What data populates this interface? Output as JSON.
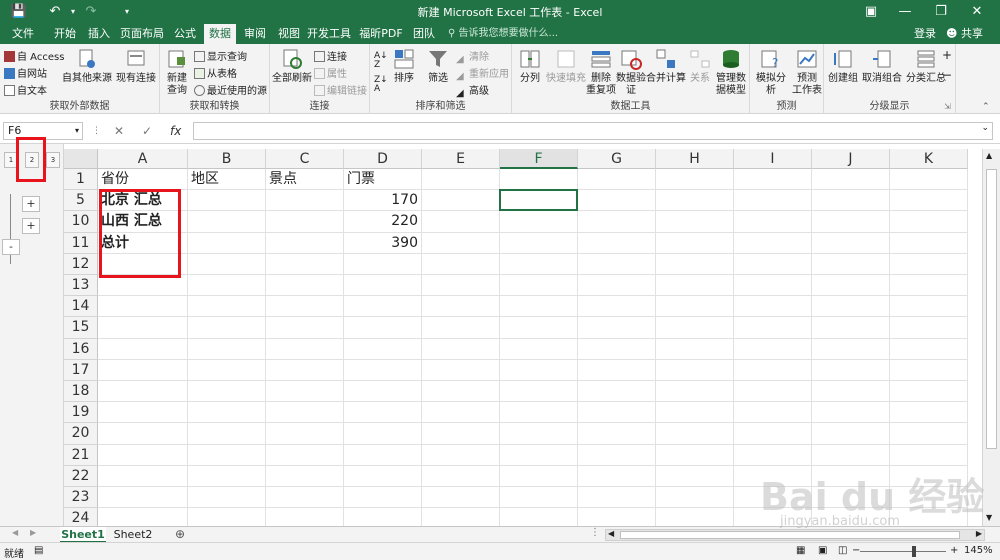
{
  "window": {
    "title": "新建 Microsoft Excel 工作表 - Excel"
  },
  "menu": {
    "tabs": [
      "文件",
      "开始",
      "插入",
      "页面布局",
      "公式",
      "数据",
      "审阅",
      "视图",
      "开发工具",
      "福昕PDF",
      "团队"
    ],
    "active": "数据",
    "tell_me": "告诉我您想要做什么...",
    "login": "登录",
    "share": "共享"
  },
  "ribbon": {
    "get_external": {
      "access": "自 Access",
      "web": "自网站",
      "text": "自文本",
      "other": "自其他来源",
      "existing": "现有连接",
      "label": "获取外部数据"
    },
    "get_transform": {
      "new_query": "新建\n查询",
      "show_queries": "显示查询",
      "from_table": "从表格",
      "recent_sources": "最近使用的源",
      "label": "获取和转换"
    },
    "connections": {
      "refresh_all": "全部刷新",
      "connections": "连接",
      "properties": "属性",
      "edit_links": "编辑链接",
      "label": "连接"
    },
    "sort_filter": {
      "sort": "排序",
      "filter": "筛选",
      "clear": "清除",
      "reapply": "重新应用",
      "advanced": "高级",
      "label": "排序和筛选"
    },
    "data_tools": {
      "text_to_columns": "分列",
      "flash_fill": "快速填充",
      "remove_dup": "删除\n重复项",
      "validation": "数据验\n证",
      "consolidate": "合并计算",
      "relationships": "关系",
      "manage_model": "管理数\n据模型",
      "label": "数据工具"
    },
    "forecast": {
      "what_if": "模拟分析",
      "forecast_sheet": "预测\n工作表",
      "label": "预测"
    },
    "outline": {
      "group": "创建组",
      "ungroup": "取消组合",
      "subtotal": "分类汇总",
      "label": "分级显示"
    }
  },
  "formula_bar": {
    "name_box": "F6",
    "fx": "fx",
    "formula": ""
  },
  "outline_levels": [
    "1",
    "2",
    "3"
  ],
  "outline_buttons": [
    "+",
    "+",
    "-"
  ],
  "columns": [
    "A",
    "B",
    "C",
    "D",
    "E",
    "F",
    "G",
    "H",
    "I",
    "J",
    "K"
  ],
  "selected_column": "F",
  "rows": [
    {
      "num": "1",
      "cells": {
        "A": "省份",
        "B": "地区",
        "C": "景点",
        "D": "门票"
      }
    },
    {
      "num": "5",
      "cells": {
        "A": "北京 汇总",
        "D": "170"
      }
    },
    {
      "num": "10",
      "cells": {
        "A": "山西 汇总",
        "D": "220"
      }
    },
    {
      "num": "11",
      "cells": {
        "A": "总计",
        "D": "390"
      }
    },
    {
      "num": "12",
      "cells": {}
    },
    {
      "num": "13",
      "cells": {}
    },
    {
      "num": "14",
      "cells": {}
    },
    {
      "num": "15",
      "cells": {}
    },
    {
      "num": "16",
      "cells": {}
    },
    {
      "num": "17",
      "cells": {}
    },
    {
      "num": "18",
      "cells": {}
    },
    {
      "num": "19",
      "cells": {}
    },
    {
      "num": "20",
      "cells": {}
    },
    {
      "num": "21",
      "cells": {}
    },
    {
      "num": "22",
      "cells": {}
    },
    {
      "num": "23",
      "cells": {}
    },
    {
      "num": "24",
      "cells": {}
    }
  ],
  "sheets": [
    "Sheet1",
    "Sheet2"
  ],
  "active_sheet": "Sheet1",
  "status": {
    "ready": "就绪",
    "zoom": "145%"
  },
  "watermark": {
    "logo": "Bai du 经验",
    "url": "jingyan.baidu.com"
  },
  "colors": {
    "accent": "#217346",
    "highlight": "#e8141b"
  }
}
